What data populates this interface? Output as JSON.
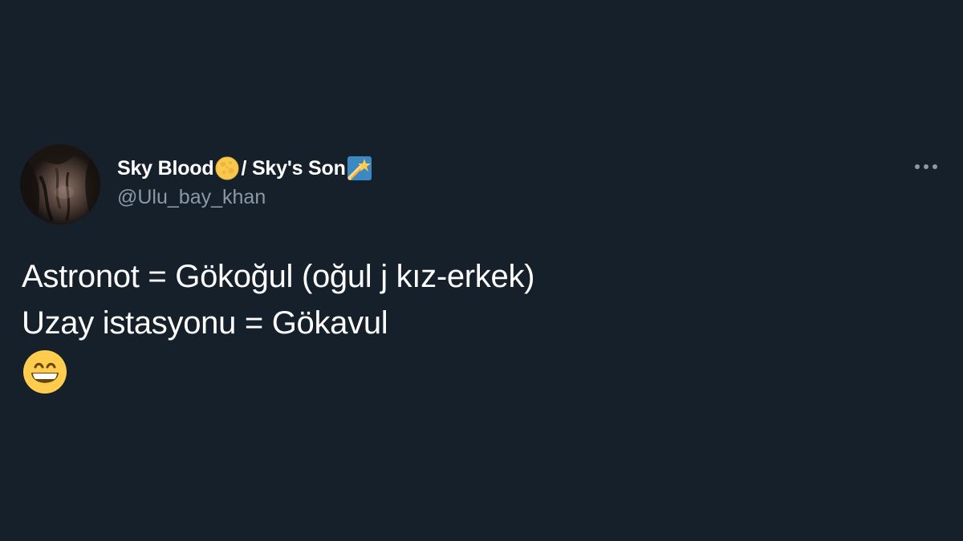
{
  "tweet": {
    "author": {
      "name_part1": "Sky Blood",
      "name_part1_emoji": "full-moon-icon",
      "name_part2": " / Sky's Son",
      "name_part2_emoji": "shooting-star-icon",
      "handle": "@Ulu_bay_khan"
    },
    "more_icon": "more-dots-icon",
    "lines": [
      "Astronot = Gökoğul (oğul j kız-erkek)",
      "Uzay istasyonu = Gökavul"
    ],
    "trailing_emoji": "grinning-face-icon"
  },
  "colors": {
    "background": "#15202b",
    "text_primary": "#ffffff",
    "text_secondary": "#8b98a5"
  }
}
